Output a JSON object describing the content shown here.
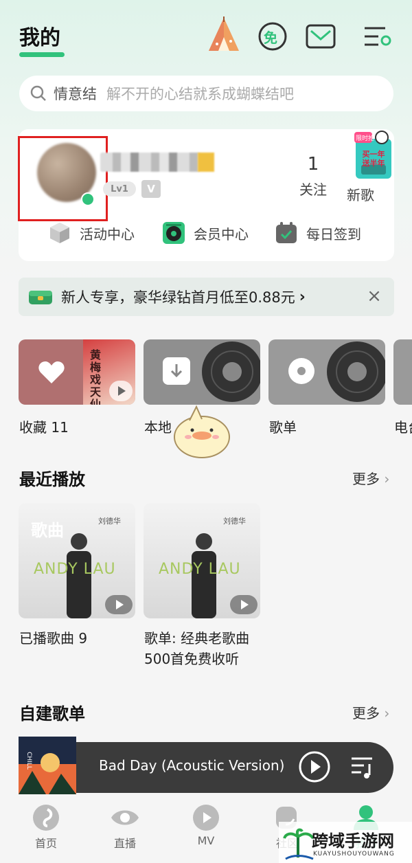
{
  "header": {
    "title": "我的",
    "free_icon_text": "免"
  },
  "search": {
    "keyword": "情意结",
    "hint": "解不开的心结就系成蝴蝶结吧"
  },
  "profile": {
    "level_badge": "Lv1",
    "follow_count": "1",
    "follow_label": "关注",
    "newsong_label": "新歌",
    "promo_badge_top": "限时抢",
    "promo_badge_text": "买一年 送半年"
  },
  "quick_actions": [
    {
      "label": "活动中心",
      "icon": "cube-icon"
    },
    {
      "label": "会员中心",
      "icon": "vinyl-player-icon"
    },
    {
      "label": "每日签到",
      "icon": "calendar-check-icon"
    }
  ],
  "banner": {
    "text": "新人专享，豪华绿钻首月低至0.88元",
    "chevron": "›",
    "close": "×"
  },
  "tiles": [
    {
      "label": "收藏 11",
      "icon": "heart-icon",
      "cover_text": "黄梅戏 天仙配"
    },
    {
      "label": "本地",
      "icon": "download-icon"
    },
    {
      "label": "歌单",
      "icon": "disc-icon"
    },
    {
      "label": "电台",
      "icon": "radio-icon"
    }
  ],
  "recent": {
    "title": "最近播放",
    "more": "更多",
    "items": [
      {
        "label": "已播歌曲 9",
        "overlay": "歌曲",
        "cover_text": "ANDY LAU",
        "cover_artist": "刘德华"
      },
      {
        "label": "歌单: 经典老歌曲500首免费收听",
        "cover_text": "ANDY LAU",
        "cover_artist": "刘德华"
      }
    ]
  },
  "playlists": {
    "title": "自建歌单",
    "more": "更多"
  },
  "player": {
    "title": "Bad Day (Acoustic Version)",
    "cover_text": "CHILL"
  },
  "nav": [
    {
      "label": "首页",
      "icon": "music-note-icon"
    },
    {
      "label": "直播",
      "icon": "eye-icon"
    },
    {
      "label": "MV",
      "icon": "video-play-icon"
    },
    {
      "label": "社区",
      "icon": "community-icon"
    },
    {
      "label": "我的",
      "icon": "profile-icon"
    }
  ],
  "watermark": {
    "text": "跨域手游网",
    "subtext": "KUAYUSHOUYOUWANG"
  },
  "colors": {
    "accent": "#31c27c",
    "highlight_box": "#e02020",
    "player_bg": "#3b3b3b"
  }
}
